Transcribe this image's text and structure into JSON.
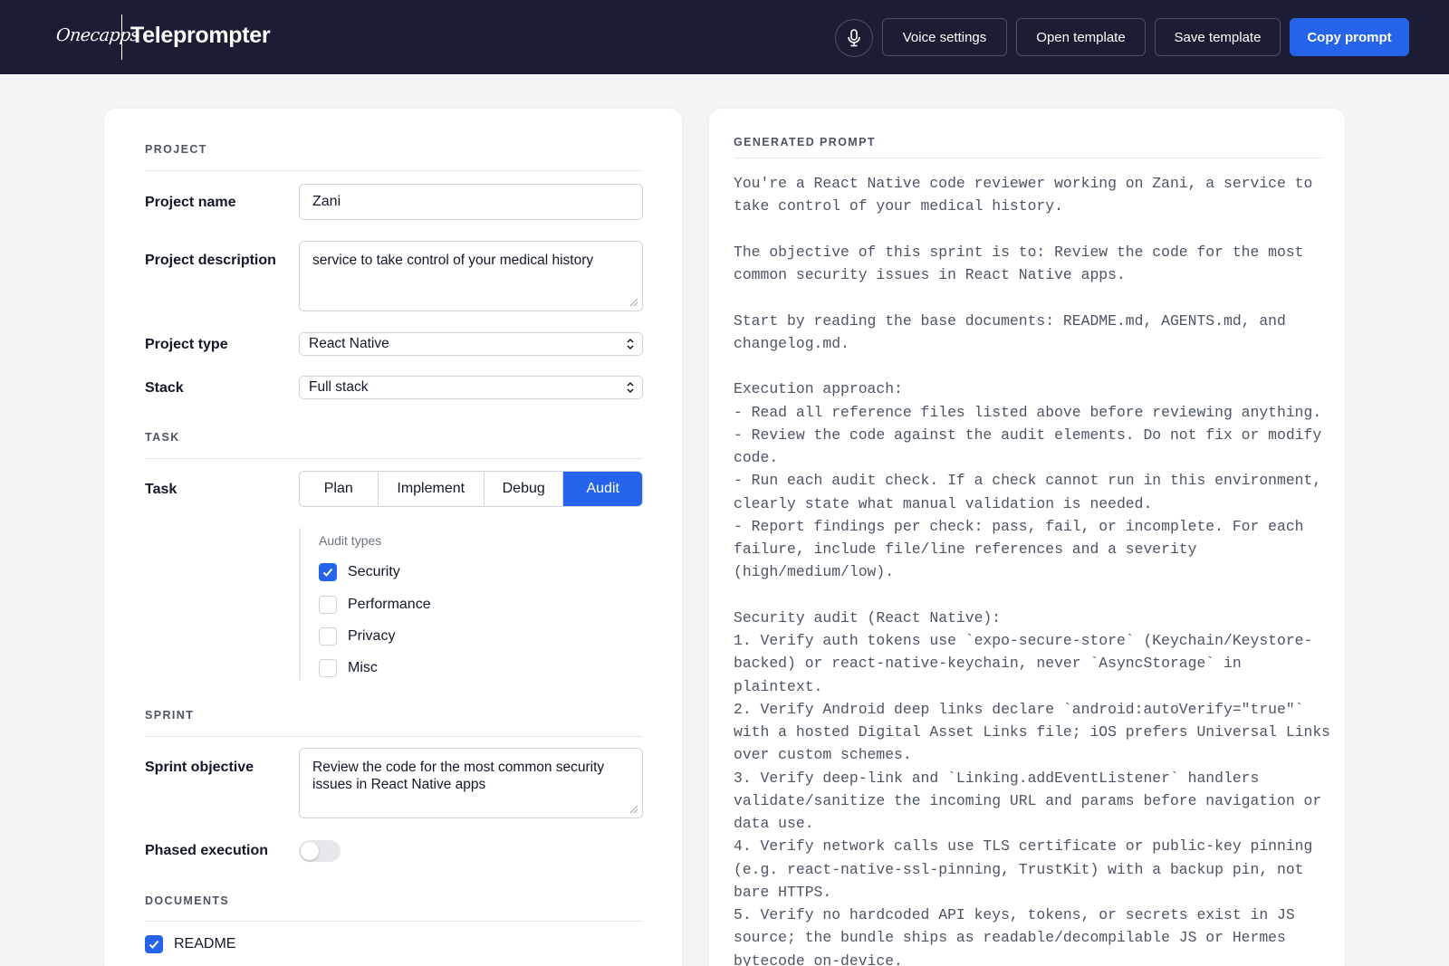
{
  "header": {
    "logo_text": "Onecapps",
    "app_title": "Teleprompter",
    "buttons": {
      "voice_settings": "Voice settings",
      "open_template": "Open template",
      "save_template": "Save template",
      "copy_prompt": "Copy prompt"
    },
    "icons": {
      "mic": "microphone-icon"
    },
    "colors": {
      "bar": "#1b1d35",
      "primary": "#2563eb"
    }
  },
  "form": {
    "project": {
      "section_title": "PROJECT",
      "name_label": "Project name",
      "name_value": "Zani",
      "description_label": "Project description",
      "description_value": "service to take control of your medical history",
      "type_label": "Project type",
      "type_value": "React Native",
      "stack_label": "Stack",
      "stack_value": "Full stack"
    },
    "task": {
      "section_title": "TASK",
      "label": "Task",
      "options": [
        "Plan",
        "Implement",
        "Debug",
        "Audit"
      ],
      "selected": "Audit",
      "audit_types_caption": "Audit types",
      "audit_types": [
        {
          "label": "Security",
          "checked": true
        },
        {
          "label": "Performance",
          "checked": false
        },
        {
          "label": "Privacy",
          "checked": false
        },
        {
          "label": "Misc",
          "checked": false
        }
      ]
    },
    "sprint": {
      "section_title": "SPRINT",
      "objective_label": "Sprint objective",
      "objective_value": "Review the code for the most common security issues in React Native apps",
      "phased_label": "Phased execution",
      "phased_enabled": false
    },
    "documents": {
      "section_title": "DOCUMENTS",
      "items": [
        {
          "label": "README",
          "checked": true
        }
      ]
    }
  },
  "generated": {
    "title": "GENERATED PROMPT",
    "text": "You're a React Native code reviewer working on Zani, a service to take control of your medical history.\n\nThe objective of this sprint is to: Review the code for the most common security issues in React Native apps.\n\nStart by reading the base documents: README.md, AGENTS.md, and changelog.md.\n\nExecution approach:\n- Read all reference files listed above before reviewing anything.\n- Review the code against the audit elements. Do not fix or modify code.\n- Run each audit check. If a check cannot run in this environment, clearly state what manual validation is needed.\n- Report findings per check: pass, fail, or incomplete. For each failure, include file/line references and a severity (high/medium/low).\n\nSecurity audit (React Native):\n1. Verify auth tokens use `expo-secure-store` (Keychain/Keystore-backed) or react-native-keychain, never `AsyncStorage` in plaintext.\n2. Verify Android deep links declare `android:autoVerify=\"true\"` with a hosted Digital Asset Links file; iOS prefers Universal Links over custom schemes.\n3. Verify deep-link and `Linking.addEventListener` handlers validate/sanitize the incoming URL and params before navigation or data use.\n4. Verify network calls use TLS certificate or public-key pinning (e.g. react-native-ssl-pinning, TrustKit) with a backup pin, not bare HTTPS.\n5. Verify no hardcoded API keys, tokens, or secrets exist in JS source; the bundle ships as readable/decompilable JS or Hermes bytecode on-device."
  }
}
